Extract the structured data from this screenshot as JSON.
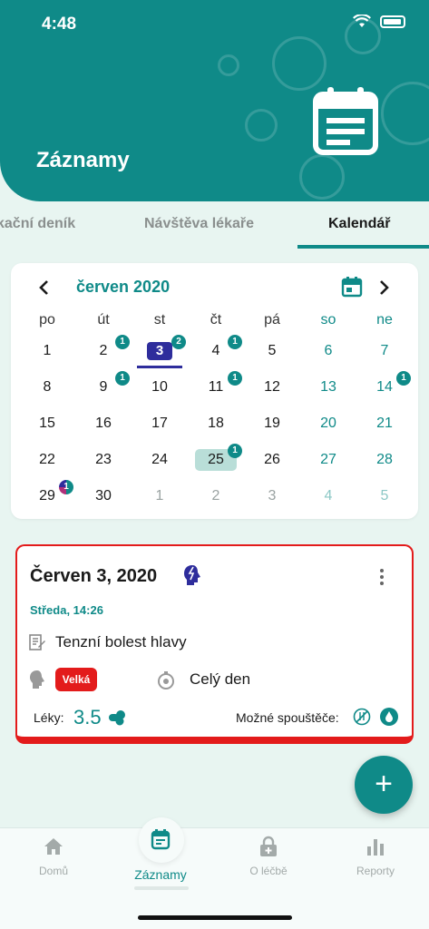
{
  "status": {
    "time": "4:48"
  },
  "header": {
    "title": "Záznamy"
  },
  "tabs": [
    {
      "label": "kační deník"
    },
    {
      "label": "Návštěva lékaře"
    },
    {
      "label": "Kalendář"
    }
  ],
  "calendar": {
    "month": "červen 2020",
    "weekdays": [
      "po",
      "út",
      "st",
      "čt",
      "pá",
      "so",
      "ne"
    ],
    "weeks": [
      [
        {
          "d": "1"
        },
        {
          "d": "2",
          "b": "1"
        },
        {
          "d": "3",
          "b": "2",
          "today": true
        },
        {
          "d": "4",
          "b": "1"
        },
        {
          "d": "5"
        },
        {
          "d": "6"
        },
        {
          "d": "7"
        }
      ],
      [
        {
          "d": "8"
        },
        {
          "d": "9",
          "b": "1"
        },
        {
          "d": "10"
        },
        {
          "d": "11",
          "b": "1"
        },
        {
          "d": "12"
        },
        {
          "d": "13"
        },
        {
          "d": "14",
          "b": "1"
        }
      ],
      [
        {
          "d": "15"
        },
        {
          "d": "16"
        },
        {
          "d": "17"
        },
        {
          "d": "18"
        },
        {
          "d": "19"
        },
        {
          "d": "20"
        },
        {
          "d": "21"
        }
      ],
      [
        {
          "d": "22"
        },
        {
          "d": "23"
        },
        {
          "d": "24"
        },
        {
          "d": "25",
          "b": "1",
          "selected": true
        },
        {
          "d": "26"
        },
        {
          "d": "27"
        },
        {
          "d": "28"
        }
      ],
      [
        {
          "d": "29",
          "b": "1",
          "multi": true
        },
        {
          "d": "30"
        },
        {
          "d": "1",
          "other": true
        },
        {
          "d": "2",
          "other": true
        },
        {
          "d": "3",
          "other": true
        },
        {
          "d": "4",
          "other": true
        },
        {
          "d": "5",
          "other": true
        }
      ]
    ]
  },
  "record": {
    "title": "Červen 3, 2020",
    "subtitle": "Středa, 14:26",
    "diagnosis": "Tenzní bolest hlavy",
    "intensity": "Velká",
    "duration": "Celý den",
    "meds_label": "Léky:",
    "meds_value": "3.5",
    "triggers_label": "Možné spouštěče:"
  },
  "fab": {
    "label": "+"
  },
  "nav": [
    {
      "label": "Domů",
      "icon": "home-icon"
    },
    {
      "label": "Záznamy",
      "icon": "records-icon"
    },
    {
      "label": "O léčbě",
      "icon": "lock-plus-icon"
    },
    {
      "label": "Reporty",
      "icon": "bar-chart-icon"
    }
  ],
  "colors": {
    "accent": "#0f8a88",
    "today": "#2e2d9c",
    "alert": "#e31b1b",
    "selected": "#b9ded8"
  }
}
